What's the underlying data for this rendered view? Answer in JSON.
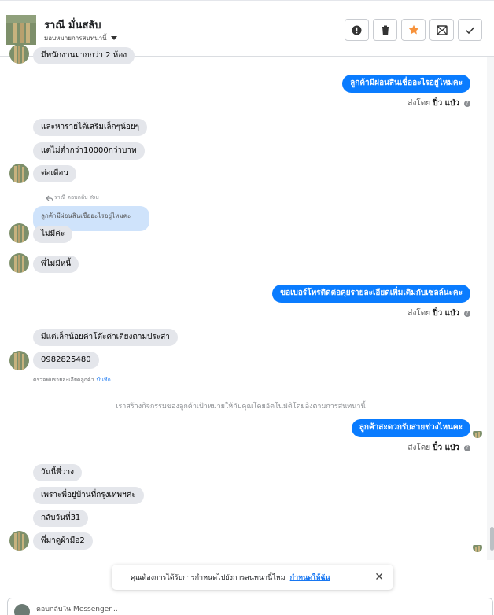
{
  "header": {
    "name": "ราณี มั่นสลับ",
    "assign_label": "มอบหมายการสนทนานี้",
    "tools": [
      "exclamation-icon",
      "trash-icon",
      "star-icon",
      "mail-icon",
      "check-icon"
    ],
    "star_color": "#f7923b"
  },
  "messages": {
    "in0": "มีพนักงานมากกว่า 2 ห้อง",
    "out1": "ลูกค้ามีผ่อนสินเชื่ออะไรอยู่ไหมคะ",
    "sent_prefix": "ส่งโดย",
    "sent_by": "ปิ๋ว แป่ว",
    "in1": "และหารายได้เสริมเล็กๆน้อยๆ",
    "in2": "แต่ไม่ต่ำกว่า10000กว่าบาท",
    "in3": "ต่อเดือน",
    "reply_label": "ราณี ตอบกลับ You",
    "quoted": "ลูกค้ามีผ่อนสินเชื่ออะไรอยู่ไหมคะ",
    "in4": "ไม่มีค่ะ",
    "in5": "พี่ไม่มีหนี้",
    "out2": "ขอเบอร์โทรติดต่อคุยรายละเอียดเพิ่มเติมกับเซลล์นะคะ",
    "in6": "มีแต่เล็กน้อยค่าโต๊ะค่าเตียงตามประสา",
    "phone": "0982825480",
    "note": "ตรวจพบรายละเอียดลูกค้า",
    "note_link": "บันทึก",
    "system": "เราสร้างกิจกรรมของลูกค้าเป้าหมายให้กับคุณโดยอัตโนมัติโดยอิงตามการสนทนานี้",
    "out3": "ลูกค้าสะดวกรับสายช่วงไหนคะ",
    "in7": "วันนี้พี่ว่าง",
    "in8": "เพราะพี่อยู่บ้านที่กรุงเทพฯค่ะ",
    "in9": "กลับวันที่31",
    "in10": "พี่มาดูผ้ามือ2"
  },
  "toast": {
    "text": "คุณต้องการได้รับการกำหนดไปยังการสนทนานี้ไหม",
    "action": "กำหนดให้ฉัน",
    "close": "✕"
  },
  "composer": {
    "placeholder": "ตอบกลับใน Messenger..."
  },
  "colors": {
    "outgoing": "#0a7cff",
    "incoming": "#e4e6eb",
    "link": "#1877f2"
  }
}
